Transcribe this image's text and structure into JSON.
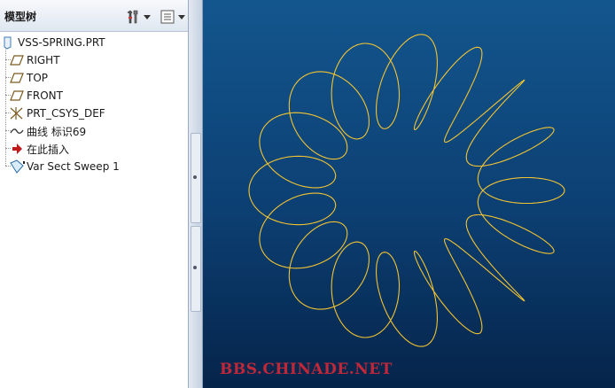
{
  "panel": {
    "title": "模型树",
    "settings_icon": "tools-icon",
    "show_icon": "list-icon"
  },
  "tree": {
    "root": "VSS-SPRING.PRT",
    "items": [
      {
        "label": "RIGHT",
        "icon": "datum-plane-icon"
      },
      {
        "label": "TOP",
        "icon": "datum-plane-icon"
      },
      {
        "label": "FRONT",
        "icon": "datum-plane-icon"
      },
      {
        "label": "PRT_CSYS_DEF",
        "icon": "csys-icon"
      },
      {
        "label": "曲线 标识69",
        "icon": "curve-icon"
      },
      {
        "label": "在此插入",
        "icon": "insert-arrow-icon"
      },
      {
        "label": "Var Sect Sweep 1",
        "icon": "sweep-icon"
      }
    ]
  },
  "viewport": {
    "watermark": "BBS.CHINADE.NET",
    "curve_color": "#f3c431",
    "background_top": "#13568e",
    "background_bottom": "#05244a"
  }
}
